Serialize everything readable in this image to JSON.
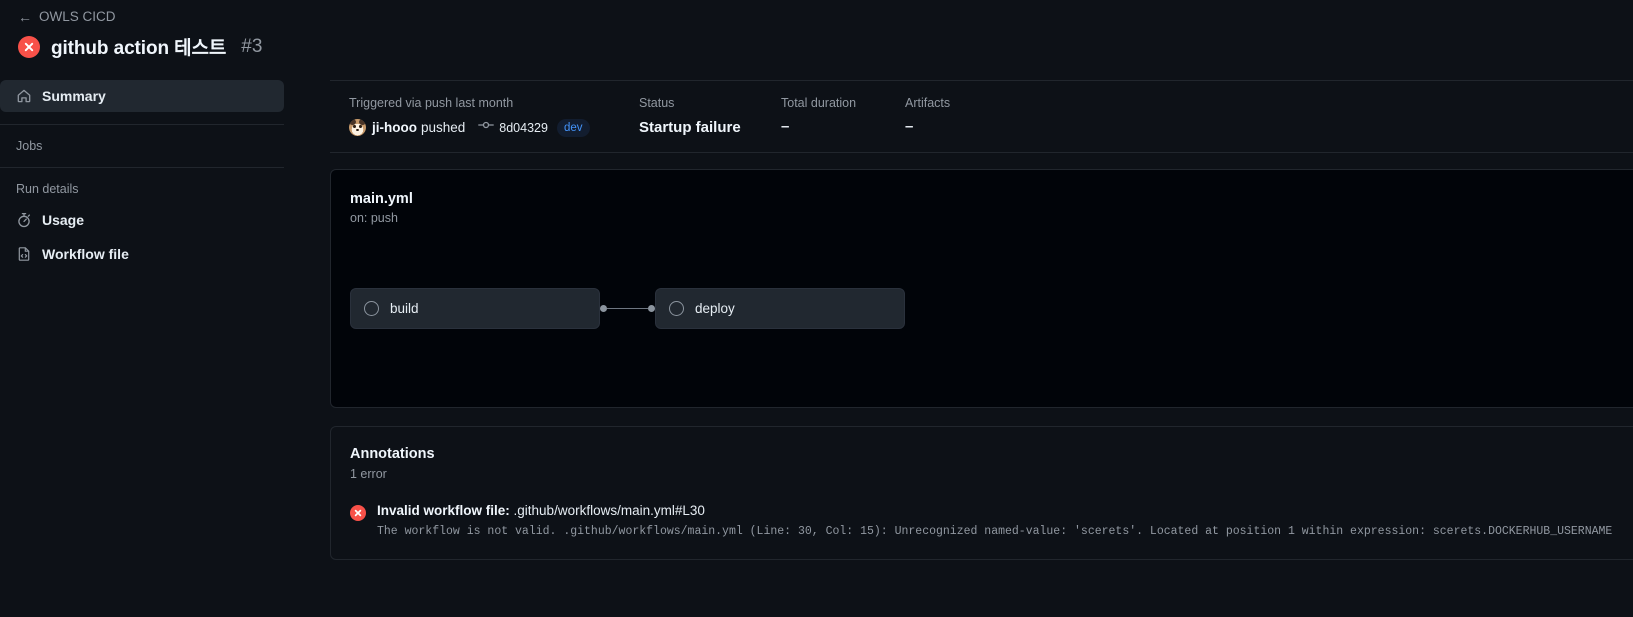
{
  "header": {
    "back_arrow": "←",
    "repo": "OWLS CICD",
    "status_icon": "x-circle-fail-icon",
    "run_title": "github action 테스트",
    "run_number": "#3"
  },
  "sidebar": {
    "summary": {
      "label": "Summary",
      "icon": "home-icon"
    },
    "jobs_heading": "Jobs",
    "run_details_heading": "Run details",
    "items": [
      {
        "label": "Usage",
        "icon": "stopwatch-icon"
      },
      {
        "label": "Workflow file",
        "icon": "file-code-icon"
      }
    ]
  },
  "meta": {
    "trigger_label": "Triggered via push last month",
    "pusher": "ji-hooo",
    "pushed_word": "pushed",
    "commit_icon": "git-commit-icon",
    "commit_sha": "8d04329",
    "branch": "dev",
    "status_label": "Status",
    "status_value": "Startup failure",
    "duration_label": "Total duration",
    "duration_value": "–",
    "artifacts_label": "Artifacts",
    "artifacts_value": "–"
  },
  "workflow": {
    "name": "main.yml",
    "trigger": "on: push",
    "jobs": [
      {
        "label": "build",
        "status_icon": "circle-pending-icon"
      },
      {
        "label": "deploy",
        "status_icon": "circle-pending-icon"
      }
    ]
  },
  "annotations": {
    "title": "Annotations",
    "count": "1 error",
    "error_icon": "x-circle-fail-icon",
    "headline_bold": "Invalid workflow file:",
    "headline_path": ".github/workflows/main.yml#L30",
    "detail": "The workflow is not valid. .github/workflows/main.yml (Line: 30, Col: 15): Unrecognized named-value: 'scerets'. Located at position 1 within expression: scerets.DOCKERHUB_USERNAME"
  },
  "colors": {
    "accent": "#1f6feb",
    "danger": "#f85149",
    "link": "#4493f8",
    "muted": "#9198a1"
  }
}
